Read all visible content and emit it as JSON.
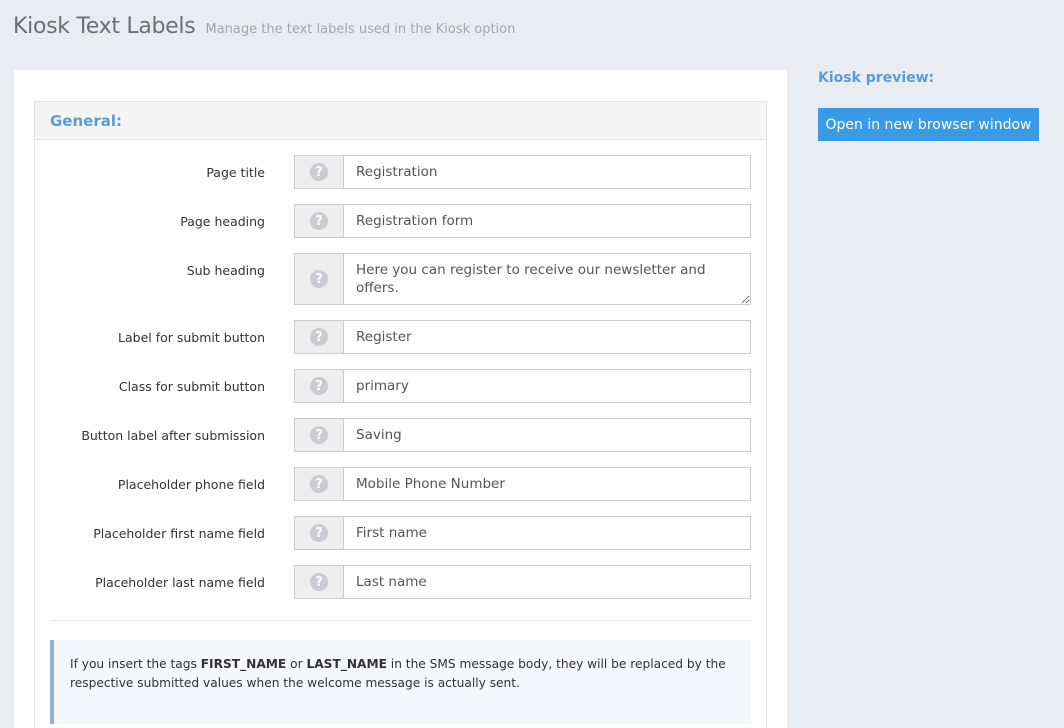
{
  "header": {
    "title": "Kiosk Text Labels",
    "subtitle": "Manage the text labels used in the Kiosk option"
  },
  "panel": {
    "heading": "General:"
  },
  "help_icon": "question-circle-icon",
  "fields": [
    {
      "label": "Page title",
      "value": "Registration"
    },
    {
      "label": "Page heading",
      "value": "Registration form"
    },
    {
      "label": "Sub heading",
      "value": "Here you can register to receive our newsletter and offers."
    },
    {
      "label": "Label for submit button",
      "value": "Register"
    },
    {
      "label": "Class for submit button",
      "value": "primary"
    },
    {
      "label": "Button label after submission",
      "value": "Saving"
    },
    {
      "label": "Placeholder phone field",
      "value": "Mobile Phone Number"
    },
    {
      "label": "Placeholder first name field",
      "value": "First name"
    },
    {
      "label": "Placeholder last name field",
      "value": "Last name"
    }
  ],
  "info": {
    "text_1": "If you insert the tags ",
    "tag_1": "FIRST_NAME",
    "text_2": " or ",
    "tag_2": "LAST_NAME",
    "text_3": " in the SMS message body, they will be replaced by the respective submitted values when the welcome message is actually sent."
  },
  "sidebar": {
    "title": "Kiosk preview:",
    "button_label": "Open in new browser window"
  },
  "colors": {
    "accent": "#5b9bd5",
    "button": "#3a9ae6",
    "background": "#e9ecf3"
  }
}
